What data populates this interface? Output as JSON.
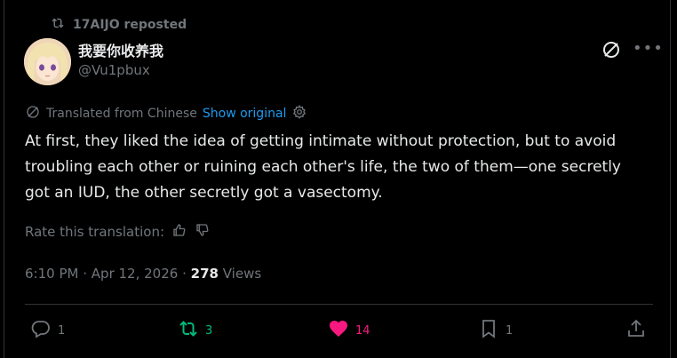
{
  "repost": {
    "label": "17AIJO reposted"
  },
  "author": {
    "display_name": "我要你收养我",
    "handle": "@Vu1pbux"
  },
  "translation": {
    "label": "Translated from Chinese",
    "show_original": "Show original"
  },
  "tweet": {
    "text": "At first, they liked the idea of getting intimate without protection, but to avoid troubling each other or ruining each other's life, the two of them—one secretly got an IUD, the other secretly got a vasectomy."
  },
  "rate": {
    "label": "Rate this translation:"
  },
  "meta": {
    "time": "6:10 PM",
    "sep1": "·",
    "date": "Apr 12, 2026",
    "sep2": "·",
    "views_count": "278",
    "views_label": "Views"
  },
  "actions": {
    "reply_count": "1",
    "repost_count": "3",
    "like_count": "14",
    "bookmark_count": "1"
  },
  "colors": {
    "background": "#000000",
    "text": "#e7e9ea",
    "muted": "#71767b",
    "link": "#1d9bf0",
    "repost": "#00ba7c",
    "like": "#f91880",
    "border": "#2f3336"
  }
}
